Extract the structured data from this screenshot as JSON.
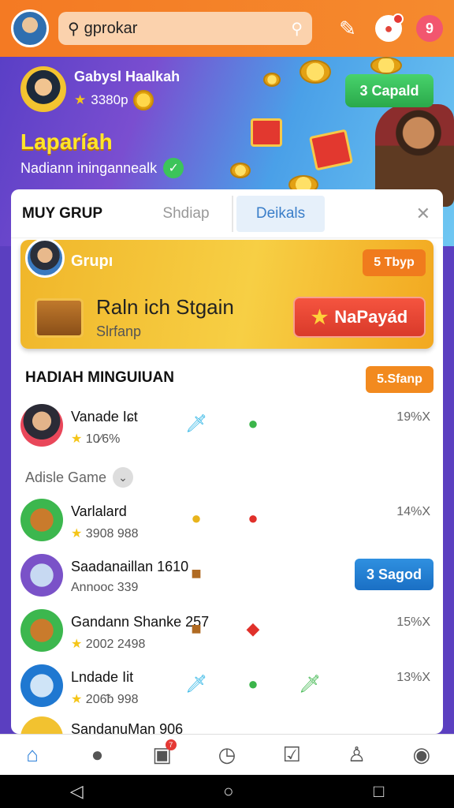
{
  "topbar": {
    "search_value": "ɡprokar",
    "icons": [
      "pencil-icon",
      "notification-icon",
      "help-icon"
    ],
    "help_label": "9"
  },
  "hero": {
    "user_name": "Gabysl Haalkah",
    "user_points": "3380p",
    "title": "Laparíah",
    "subtitle": "Nadiann iningannealk",
    "button_label": "3 Capald"
  },
  "tabs": [
    {
      "label": "MUY GRUP"
    },
    {
      "label": "Shdiap"
    },
    {
      "label": "Deikals"
    }
  ],
  "promo": {
    "group_label": "Grupı",
    "badge": "5 Tbyp",
    "title": "Raln ich Stgain",
    "subtitle": "Slrfanp",
    "button_label": "NaPayád"
  },
  "section": {
    "title": "HADIAH MINGUIUAN",
    "badge": "5.Sfanp"
  },
  "divider_label": "Adisle Game",
  "rows": [
    {
      "name": "Vanade Iɕt",
      "sub": "10⁄6%",
      "pct": "19%X"
    },
    {
      "name": "Varlalard",
      "sub": "3908 988",
      "pct": "14%X"
    },
    {
      "name": "Saadanaillan 1610",
      "sub": "Annooc 339",
      "button": "3 Sagod"
    },
    {
      "name": "Gandann Shanke 257",
      "sub": "2002 2498",
      "pct": "15%X"
    },
    {
      "name": "Lndade Iit",
      "sub": "206ᵬ 998",
      "pct": "13%X"
    },
    {
      "name": "SandanuMan 906"
    }
  ],
  "nav": {
    "items": [
      "home-icon",
      "chat-icon",
      "calendar-icon",
      "clock-icon",
      "mail-icon",
      "profile-icon",
      "games-icon"
    ],
    "calendar_badge": "7"
  },
  "colors": {
    "topbar": "#f47a23",
    "accent_blue": "#2a7fd9",
    "gold": "#f5c518"
  }
}
